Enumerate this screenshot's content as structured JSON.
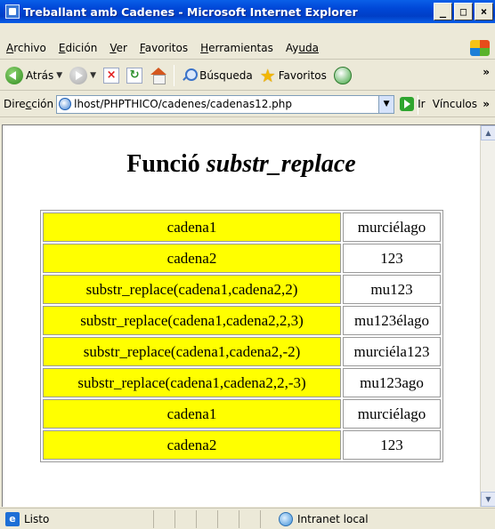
{
  "window": {
    "title": "Treballant amb Cadenes - Microsoft Internet Explorer",
    "buttons": {
      "minimize": "_",
      "maximize": "□",
      "close": "×"
    }
  },
  "menu": {
    "items": [
      {
        "first": "A",
        "rest": "rchivo"
      },
      {
        "first": "E",
        "rest": "dición"
      },
      {
        "first": "V",
        "rest": "er"
      },
      {
        "first": "F",
        "rest": "avoritos"
      },
      {
        "first": "H",
        "rest": "erramientas"
      },
      {
        "first": "Ay",
        "rest": "uda"
      }
    ]
  },
  "toolbar": {
    "back_label": "Atrás",
    "search_label": "Búsqueda",
    "favorites_label": "Favoritos",
    "overflow": "»"
  },
  "address": {
    "label_pre": "Dire",
    "label_u": "c",
    "label_post": "ción",
    "url": "lhost/PHPTHICO/cadenes/cadenas12.php",
    "go_label": "Ir",
    "links_label": "Vínculos",
    "overflow": "»"
  },
  "page": {
    "title_plain": "Funció ",
    "title_italic": "substr_replace",
    "rows": [
      {
        "key": "cadena1",
        "value": "murciélago"
      },
      {
        "key": "cadena2",
        "value": "123"
      },
      {
        "key": "substr_replace(cadena1,cadena2,2)",
        "value": "mu123"
      },
      {
        "key": "substr_replace(cadena1,cadena2,2,3)",
        "value": "mu123élago"
      },
      {
        "key": "substr_replace(cadena1,cadena2,-2)",
        "value": "murciéla123"
      },
      {
        "key": "substr_replace(cadena1,cadena2,2,-3)",
        "value": "mu123ago"
      },
      {
        "key": "cadena1",
        "value": "murciélago"
      },
      {
        "key": "cadena2",
        "value": "123"
      }
    ],
    "key_color": "#ffff00"
  },
  "status": {
    "text": "Listo",
    "zone": "Intranet local"
  }
}
